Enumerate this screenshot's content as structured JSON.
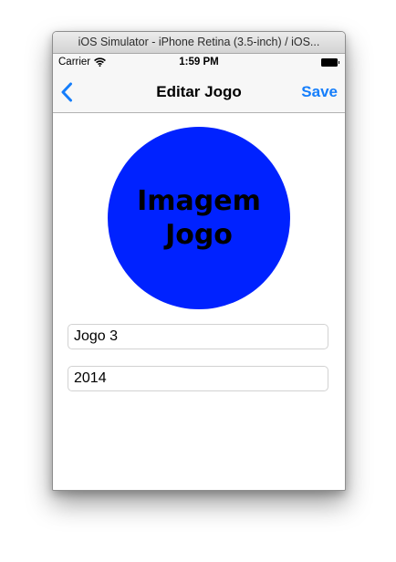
{
  "window": {
    "title": "iOS Simulator - iPhone Retina (3.5-inch) / iOS..."
  },
  "status_bar": {
    "carrier": "Carrier",
    "time": "1:59 PM",
    "wifi_icon": "wifi-icon",
    "battery_icon": "battery-icon"
  },
  "nav_bar": {
    "back_icon": "chevron-left-icon",
    "title": "Editar Jogo",
    "save_label": "Save",
    "accent_color": "#157efb"
  },
  "game_image": {
    "text": "Imagem Jogo",
    "fill_color": "#0022ff"
  },
  "form": {
    "name_value": "Jogo 3",
    "year_value": "2014"
  }
}
